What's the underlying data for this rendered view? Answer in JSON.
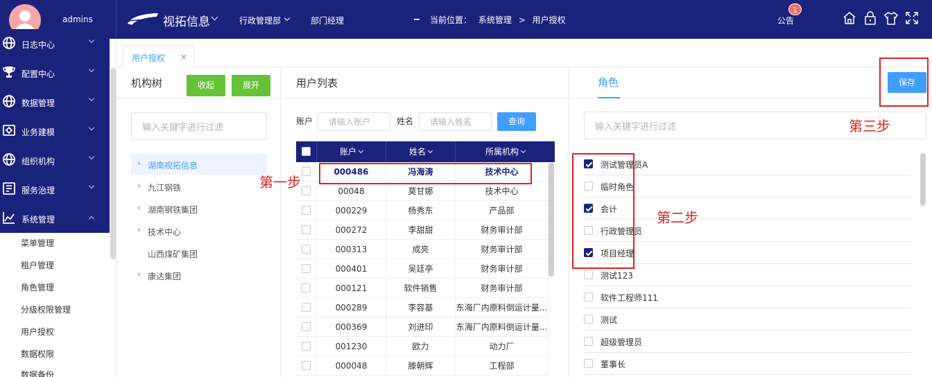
{
  "header": {
    "username": "admins",
    "system_name": "视拓信息",
    "department": "行政管理部",
    "role": "部门经理",
    "location_label": "当前位置：",
    "location_path": [
      "系统管理",
      ">",
      "用户授权"
    ],
    "notice_label": "公告",
    "notice_count": "1"
  },
  "sidebar": {
    "top_items": [
      {
        "label": "日志中心",
        "icon": "globe-icon"
      },
      {
        "label": "配置中心",
        "icon": "trophy-icon"
      },
      {
        "label": "数据管理",
        "icon": "globe-icon"
      },
      {
        "label": "业务建模",
        "icon": "settings-icon"
      },
      {
        "label": "组织机构",
        "icon": "globe-icon"
      },
      {
        "label": "服务治理",
        "icon": "document-icon"
      },
      {
        "label": "系统管理",
        "icon": "chart-icon"
      }
    ],
    "sub_items": [
      "菜单管理",
      "租户管理",
      "角色管理",
      "分级权限管理",
      "用户授权",
      "数据权限",
      "数据备份"
    ]
  },
  "tabs": [
    {
      "label": "用户授权",
      "close": "×"
    }
  ],
  "org_panel": {
    "title": "机构树",
    "collapse_label": "收起",
    "expand_label": "展开",
    "filter_placeholder": "输入关键字进行过滤",
    "nodes": [
      {
        "label": "湖南视拓信息",
        "expandable": true,
        "selected": true
      },
      {
        "label": "九江钢铁",
        "expandable": true
      },
      {
        "label": "湖南钢铁集团",
        "expandable": true
      },
      {
        "label": "技术中心",
        "expandable": true
      },
      {
        "label": "山西煤矿集团",
        "expandable": false
      },
      {
        "label": "康达集团",
        "expandable": true
      }
    ]
  },
  "user_panel": {
    "title": "用户列表",
    "account_label": "账户",
    "account_placeholder": "请输入账户",
    "name_label": "姓名",
    "name_placeholder": "请输入姓名",
    "query_label": "查询",
    "columns": [
      "账户",
      "姓名",
      "所属机构"
    ],
    "rows": [
      {
        "account": "000486",
        "name": "冯海涛",
        "org": "技术中心",
        "selected": true
      },
      {
        "account": "00048",
        "name": "莫甘娜",
        "org": "技术中心"
      },
      {
        "account": "000229",
        "name": "杨秀东",
        "org": "产品部"
      },
      {
        "account": "000272",
        "name": "李甜甜",
        "org": "财务审计部"
      },
      {
        "account": "000313",
        "name": "成亮",
        "org": "财务审计部"
      },
      {
        "account": "000401",
        "name": "吴廷亭",
        "org": "财务审计部"
      },
      {
        "account": "000121",
        "name": "软件销售",
        "org": "财务审计部"
      },
      {
        "account": "000289",
        "name": "李容基",
        "org": "东海厂内原料倒运计量..."
      },
      {
        "account": "000369",
        "name": "刘进印",
        "org": "东海厂内原料倒运计量..."
      },
      {
        "account": "001230",
        "name": "欧力",
        "org": "动力厂"
      },
      {
        "account": "000048",
        "name": "滕朝辉",
        "org": "工程部"
      }
    ]
  },
  "role_panel": {
    "tab_label": "角色",
    "save_label": "保存",
    "filter_placeholder": "输入关键字进行过滤",
    "roles": [
      {
        "label": "测试管理员A",
        "checked": true
      },
      {
        "label": "临时角色",
        "checked": false
      },
      {
        "label": "会计",
        "checked": true
      },
      {
        "label": "行政管理员",
        "checked": false
      },
      {
        "label": "项目经理",
        "checked": true
      },
      {
        "label": "测试123",
        "checked": false
      },
      {
        "label": "软件工程师111",
        "checked": false
      },
      {
        "label": "测试",
        "checked": false
      },
      {
        "label": "超级管理员",
        "checked": false
      },
      {
        "label": "董事长",
        "checked": false
      }
    ]
  },
  "annotations": {
    "step1": "第一步",
    "step2": "第二步",
    "step3": "第三步"
  },
  "colors": {
    "primary_navy": "#19237c",
    "accent_blue": "#409eff",
    "success_green": "#67c23a",
    "annotation_red": "#e02020"
  }
}
